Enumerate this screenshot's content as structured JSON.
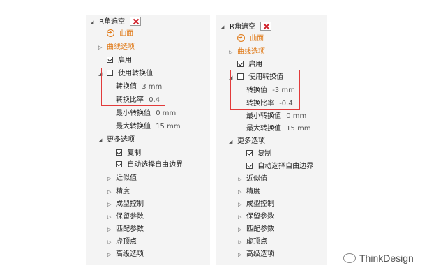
{
  "left": {
    "feature_name": "R角遍空",
    "curve_label": "曲面",
    "curve_options_label": "曲线选项",
    "enable_label": "启用",
    "use_conversion_label": "使用转换值",
    "conversion_value_label": "转换值",
    "conversion_value": "3 mm",
    "conversion_ratio_label": "转换比率",
    "conversion_ratio": "0.4",
    "min_conversion_label": "最小转换值",
    "min_conversion": "0 mm",
    "max_conversion_label": "最大转换值",
    "max_conversion": "15 mm",
    "more_options_label": "更多选项",
    "copy_label": "复制",
    "auto_select_label": "自动选择自由边界",
    "approx_label": "近似值",
    "precision_label": "精度",
    "forming_label": "成型控制",
    "keep_params_label": "保留参数",
    "match_params_label": "匹配参数",
    "vertex_label": "虚顶点",
    "advanced_label": "高级选项"
  },
  "right": {
    "feature_name": "R角遍空",
    "curve_label": "曲面",
    "curve_options_label": "曲线选项",
    "enable_label": "启用",
    "use_conversion_label": "使用转换值",
    "conversion_value_label": "转换值",
    "conversion_value": "-3 mm",
    "conversion_ratio_label": "转换比率",
    "conversion_ratio": "-0.4",
    "min_conversion_label": "最小转换值",
    "min_conversion": "0 mm",
    "max_conversion_label": "最大转换值",
    "max_conversion": "15 mm",
    "more_options_label": "更多选项",
    "copy_label": "复制",
    "auto_select_label": "自动选择自由边界",
    "approx_label": "近似值",
    "precision_label": "精度",
    "forming_label": "成型控制",
    "keep_params_label": "保留参数",
    "match_params_label": "匹配参数",
    "vertex_label": "虚顶点",
    "advanced_label": "高级选项"
  },
  "watermark": "ThinkDesign",
  "colors": {
    "highlight": "#e23b3b",
    "accent": "#e07b1a"
  }
}
